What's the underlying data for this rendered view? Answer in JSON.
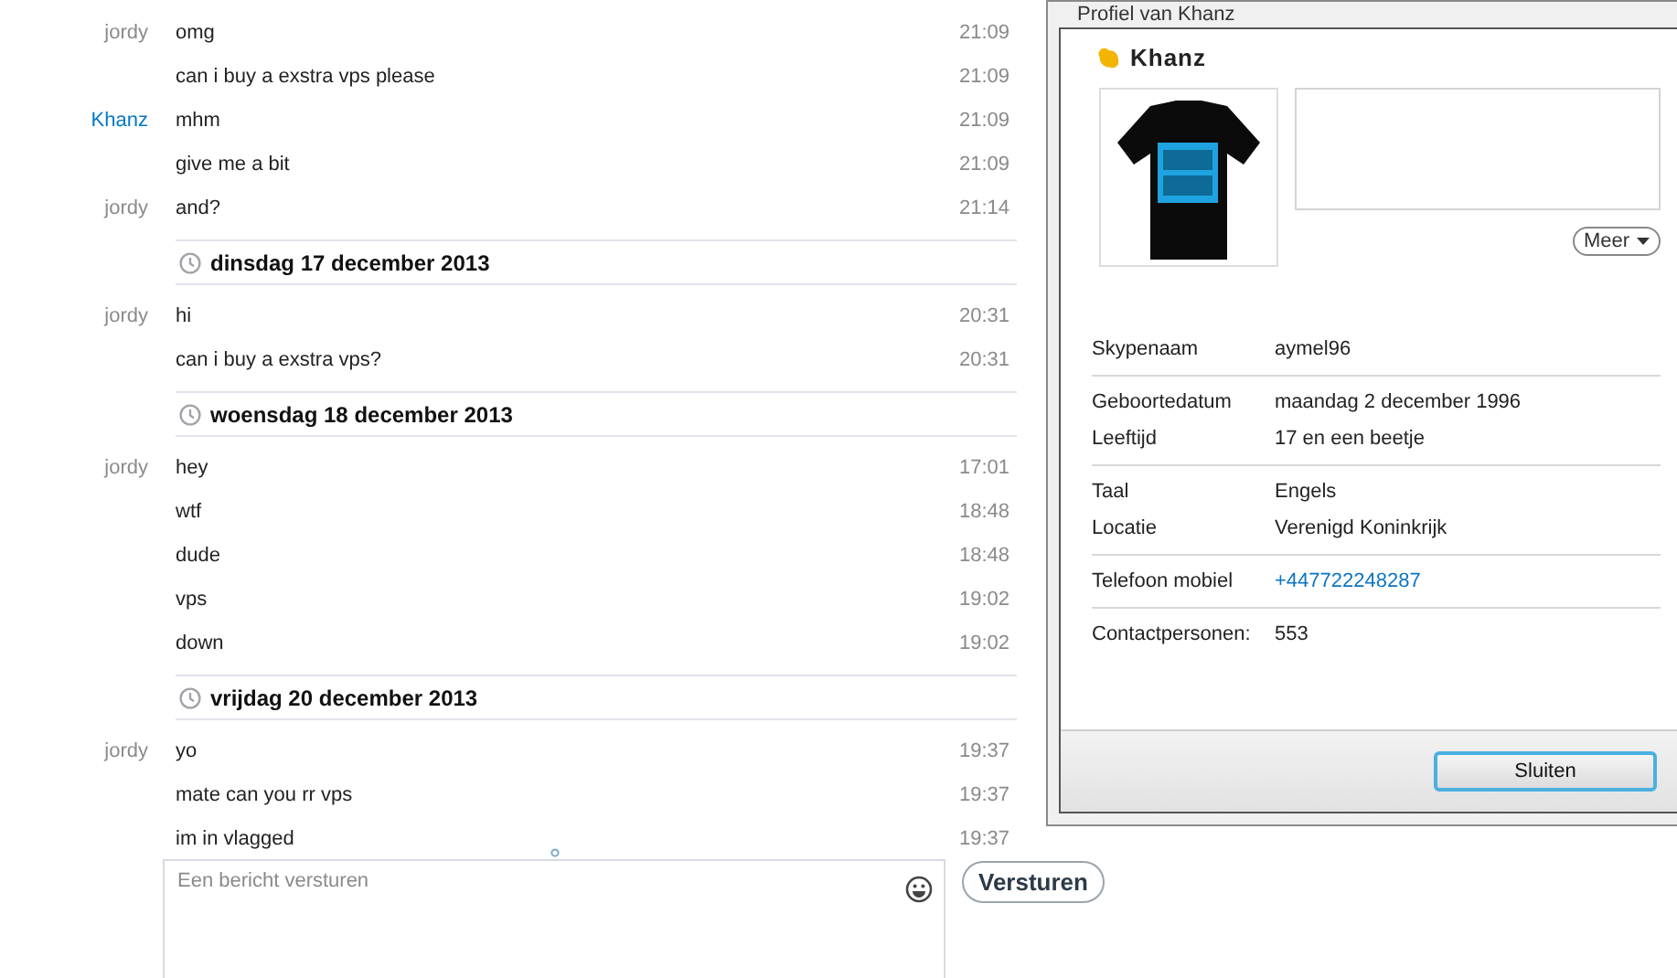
{
  "chat": {
    "items": [
      {
        "kind": "message",
        "sender": "jordy",
        "color": "#8a8a8a",
        "text": "omg",
        "time": "21:09"
      },
      {
        "kind": "message",
        "text": "can i buy a exstra vps please",
        "time": "21:09"
      },
      {
        "kind": "message",
        "sender": "Khanz",
        "color": "#0078c8",
        "text": "mhm",
        "time": "21:09"
      },
      {
        "kind": "message",
        "text": "give me a bit",
        "time": "21:09"
      },
      {
        "kind": "message",
        "sender": "jordy",
        "color": "#8a8a8a",
        "text": "and?",
        "time": "21:14"
      },
      {
        "kind": "date",
        "text": "dinsdag 17 december 2013"
      },
      {
        "kind": "message",
        "sender": "jordy",
        "color": "#8a8a8a",
        "text": "hi",
        "time": "20:31"
      },
      {
        "kind": "message",
        "text": "can i buy a exstra vps?",
        "time": "20:31"
      },
      {
        "kind": "date",
        "text": "woensdag 18 december 2013"
      },
      {
        "kind": "message",
        "sender": "jordy",
        "color": "#8a8a8a",
        "text": "hey",
        "time": "17:01"
      },
      {
        "kind": "message",
        "text": "wtf",
        "time": "18:48"
      },
      {
        "kind": "message",
        "text": "dude",
        "time": "18:48"
      },
      {
        "kind": "message",
        "text": "vps",
        "time": "19:02"
      },
      {
        "kind": "message",
        "text": "down",
        "time": "19:02"
      },
      {
        "kind": "date",
        "text": "vrijdag 20 december 2013"
      },
      {
        "kind": "message",
        "sender": "jordy",
        "color": "#8a8a8a",
        "text": "yo",
        "time": "19:37"
      },
      {
        "kind": "message",
        "text": "mate can you rr vps",
        "time": "19:37"
      },
      {
        "kind": "message",
        "text": "im in vlagged",
        "time": "19:37"
      }
    ]
  },
  "compose": {
    "placeholder": "Een bericht versturen",
    "send_button": "Versturen"
  },
  "profile_dialog": {
    "title": "Profiel van Khanz",
    "name": "Khanz",
    "status": {
      "color": "#f5b400"
    },
    "more_button": "Meer",
    "groups": [
      [
        {
          "label": "Skypenaam",
          "value": "aymel96",
          "kind": "text"
        }
      ],
      [
        {
          "label": "Geboortedatum",
          "value": "maandag 2 december 1996",
          "kind": "text"
        },
        {
          "label": "Leeftijd",
          "value": "17 en een beetje",
          "kind": "text"
        }
      ],
      [
        {
          "label": "Taal",
          "value": "Engels",
          "kind": "text"
        },
        {
          "label": "Locatie",
          "value": "Verenigd Koninkrijk",
          "kind": "text"
        }
      ],
      [
        {
          "label": "Telefoon mobiel",
          "value": "+447722248287",
          "kind": "link"
        }
      ],
      [
        {
          "label": "Contactpersonen:",
          "value": "553",
          "kind": "text"
        }
      ]
    ],
    "close_button": "Sluiten"
  }
}
